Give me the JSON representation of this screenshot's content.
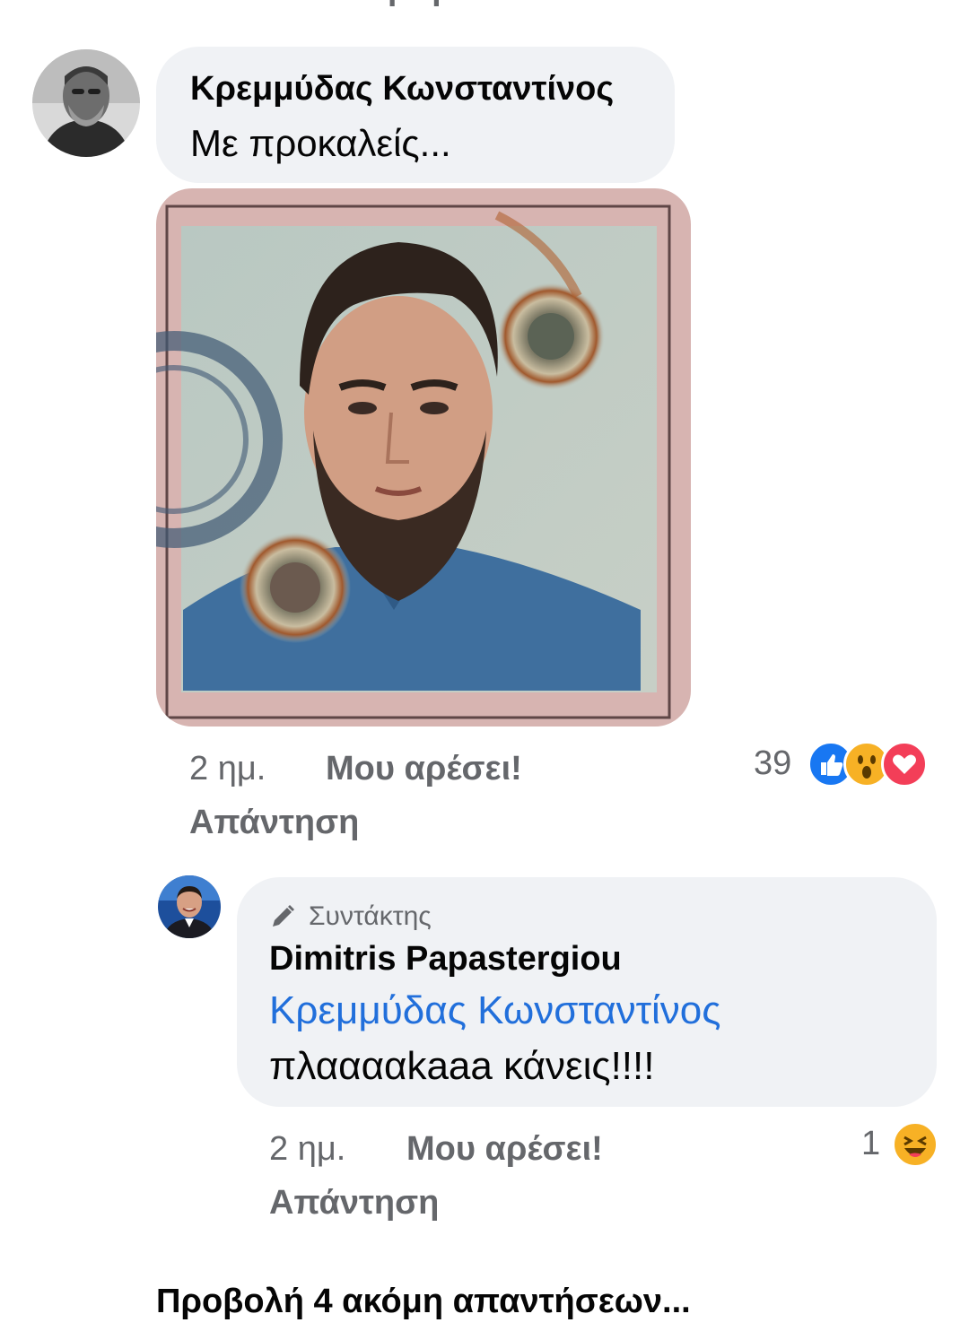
{
  "comment1": {
    "author": "Κρεμμύδας Κωνσταντίνος",
    "text": "Με προκαλείς...",
    "time": "2 ημ.",
    "like_label": "Μου αρέσει!",
    "reply_label": "Απάντηση",
    "reaction_count": "39",
    "reactions": [
      "like-icon",
      "wow-icon",
      "love-icon"
    ]
  },
  "reply1": {
    "badge": "Συντάκτης",
    "author": "Dimitris Papastergiou",
    "mention": "Κρεμμύδας Κωνσταντίνος",
    "text": "πλααααkaaa κάνεις!!!!",
    "time": "2 ημ.",
    "like_label": "Μου αρέσει!",
    "reply_label": "Απάντηση",
    "reaction_count": "1",
    "reactions": [
      "haha-icon"
    ]
  },
  "previous_reply_label": "Απάντηση",
  "more_replies": "Προβολή 4 ακόμη απαντήσεων...",
  "colors": {
    "bubble": "#f0f2f5",
    "meta": "#65676b",
    "mention": "#216fdb",
    "like_blue": "#1877f2",
    "love_red": "#f33e58",
    "emoji_yellow": "#f7b125"
  }
}
